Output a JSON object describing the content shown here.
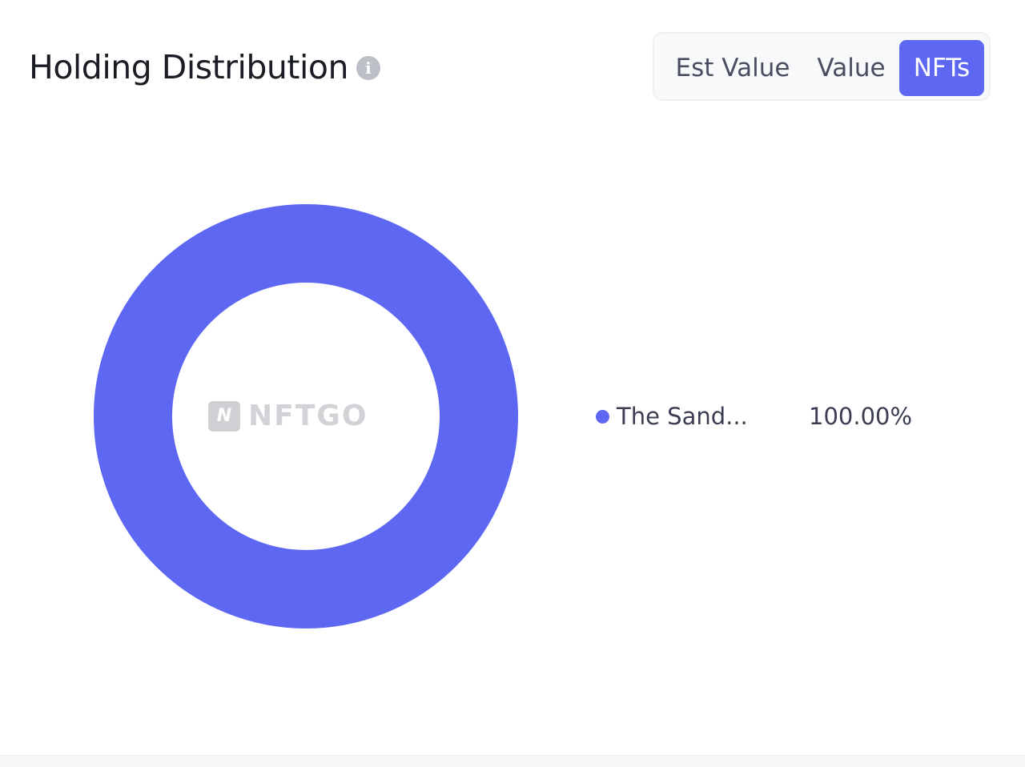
{
  "header": {
    "title": "Holding Distribution",
    "info_icon": "info-icon",
    "info_glyph": "i"
  },
  "toggle": {
    "options": [
      "Est Value",
      "Value",
      "NFTs"
    ],
    "selected": "NFTs"
  },
  "watermark": {
    "logo_glyph": "N",
    "text": "NFTGO"
  },
  "colors": {
    "accent": "#5d67f1"
  },
  "chart_data": {
    "type": "pie",
    "variant": "donut",
    "title": "",
    "slices": [
      {
        "label": "The Sand...",
        "value": 100.0,
        "display": "100.00%",
        "color": "#5d67f1"
      }
    ],
    "legend_position": "right"
  }
}
